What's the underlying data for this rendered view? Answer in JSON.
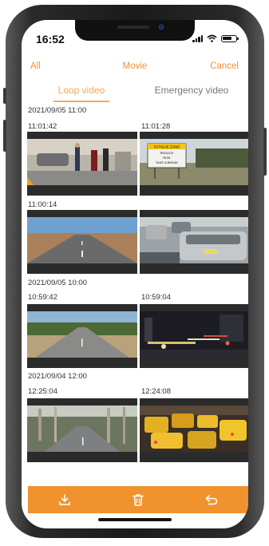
{
  "status": {
    "time": "16:52"
  },
  "nav": {
    "left": "All",
    "title": "Movie",
    "right": "Cancel"
  },
  "tabs": {
    "loop": "Loop video",
    "emergency": "Emergency video"
  },
  "groups": [
    {
      "date": "2021/09/05 11:00",
      "times": [
        "11:01:42",
        "11:01:28",
        "11:00:14"
      ]
    },
    {
      "date": "2021/09/05 10:00",
      "times": [
        "10:59:42",
        "10:59:04"
      ]
    },
    {
      "date": "2021/09/04 12:00",
      "times": [
        "12:25:04",
        "12:24:08"
      ]
    }
  ],
  "thumb_scenes": [
    "street-pedestrians",
    "fatigue-zone-sign",
    "outback-road",
    "car-traffic",
    "tree-lined-road",
    "night-traffic",
    "forest-road",
    "taxi-traffic"
  ],
  "sign_text": {
    "line1": "FATIGUE ZONE",
    "line2": "REDUCE",
    "line3": "RISK",
    "line4": "TAKE A BREAK"
  },
  "toolbar_icons": [
    "download-icon",
    "trash-icon",
    "return-icon"
  ],
  "colors": {
    "accent": "#f0922e",
    "tab_active": "#f0a860",
    "thumb_bg": "#2b2b2b"
  }
}
